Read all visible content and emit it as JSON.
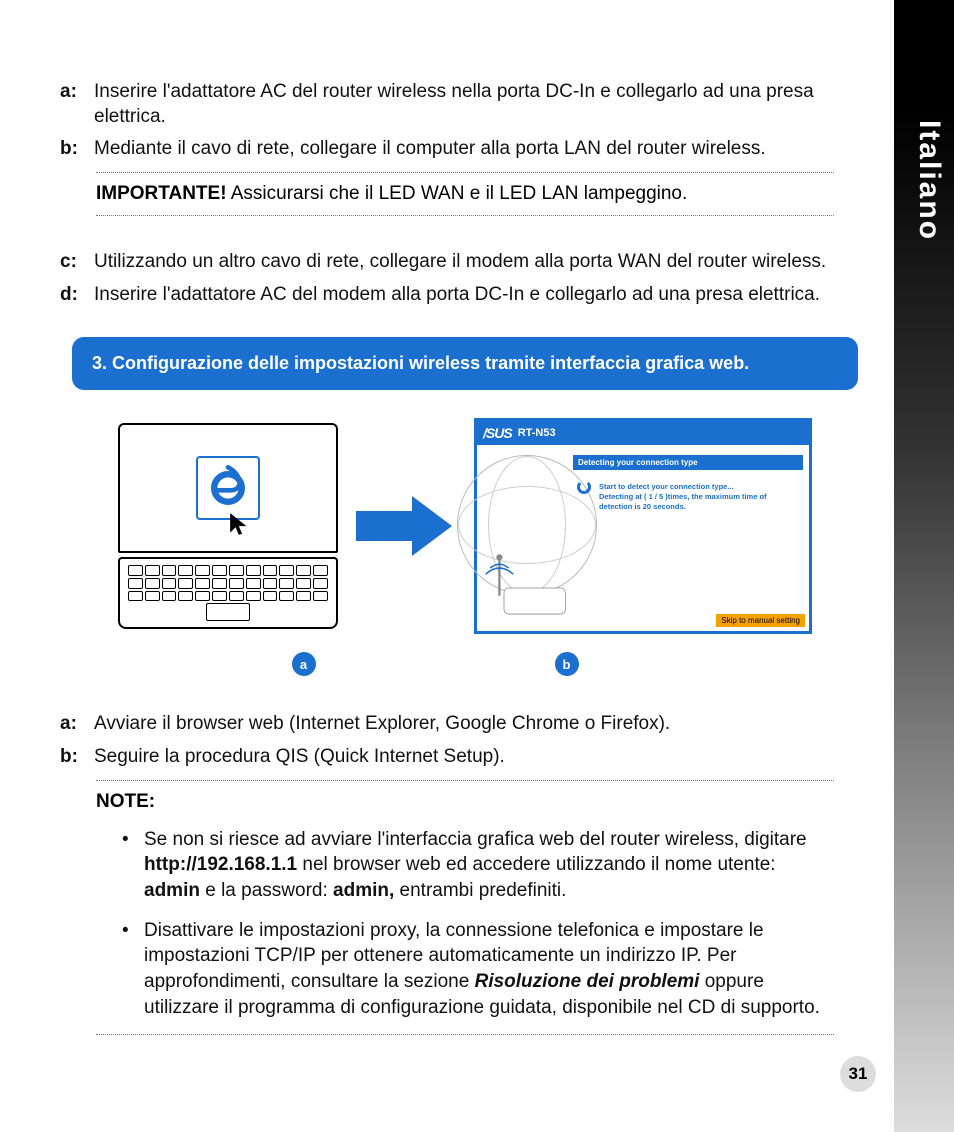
{
  "language_tab": "Italiano",
  "steps_top": {
    "a": {
      "label": "a:",
      "text": "Inserire l'adattatore AC del router wireless nella porta DC-In e collegarlo ad una presa elettrica."
    },
    "b": {
      "label": "b:",
      "text": "Mediante il cavo di rete, collegare il computer alla porta LAN del router wireless."
    }
  },
  "important": {
    "label": "IMPORTANTE!",
    "text": "  Assicurarsi che il LED WAN e il LED LAN lampeggino."
  },
  "steps_mid": {
    "c": {
      "label": "c:",
      "text": "Utilizzando un altro cavo di rete, collegare il modem alla porta WAN del router wireless."
    },
    "d": {
      "label": "d:",
      "text": "Inserire l'adattatore AC del modem alla porta DC-In e collegarlo ad una presa elettrica."
    }
  },
  "banner": "3.   Configurazione delle impostazioni wireless tramite interfaccia grafica web.",
  "asus": {
    "brand": "/SUS",
    "model": "RT-N53",
    "bar": "Detecting your connection type",
    "msg1": "Start to detect your connection type...",
    "msg2": "Detecting at ( 1 / 5 )times, the maximum time of detection is 20 seconds.",
    "skip": "Skip to manual setting"
  },
  "fig_labels": {
    "a": "a",
    "b": "b"
  },
  "steps_bottom": {
    "a": {
      "label": "a:",
      "text": "Avviare il browser web (Internet Explorer, Google Chrome o Firefox)."
    },
    "b": {
      "label": "b:",
      "text": "Seguire la procedura QIS (Quick Internet Setup)."
    }
  },
  "notes": {
    "heading": "NOTE:",
    "item1": {
      "pre": "Se non si riesce ad avviare l'interfaccia grafica web del router wireless, digitare ",
      "url": "http://192.168.1.1",
      "mid1": " nel browser web ed accedere utilizzando il nome utente: ",
      "admin1": "admin",
      "mid2": " e la password: ",
      "admin2": "admin,",
      "tail": " entrambi predefiniti."
    },
    "item2": {
      "pre": "Disattivare le impostazioni proxy, la connessione telefonica e impostare le impostazioni TCP/IP per ottenere automaticamente un indirizzo IP. Per approfondimenti, consultare la sezione ",
      "em": "Risoluzione dei problemi",
      "tail": " oppure utilizzare il programma di configurazione guidata, disponibile nel CD di supporto."
    }
  },
  "page_number": "31"
}
